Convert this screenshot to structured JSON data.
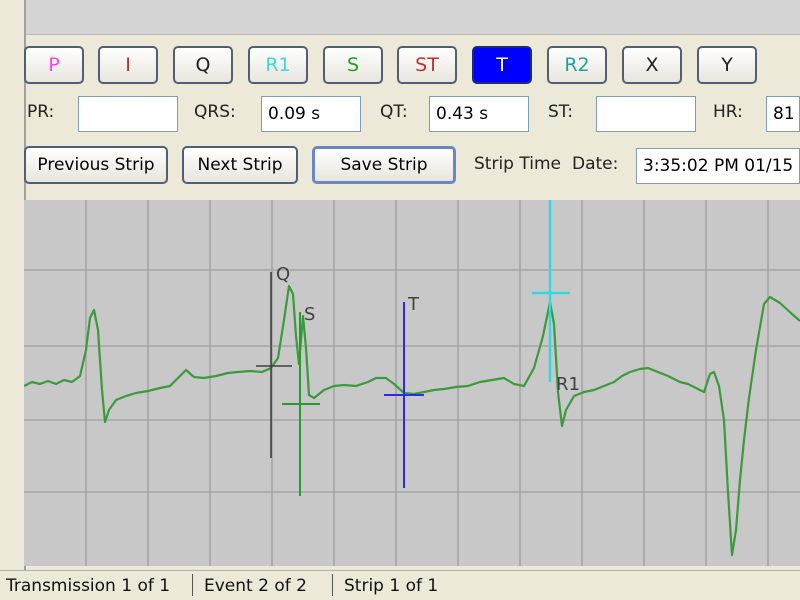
{
  "markers": [
    {
      "label": "P",
      "color": "#ff40ff",
      "bg": "",
      "selected": false
    },
    {
      "label": "I",
      "color": "#c03030",
      "bg": "",
      "selected": false
    },
    {
      "label": "Q",
      "color": "#202020",
      "bg": "",
      "selected": false
    },
    {
      "label": "R1",
      "color": "#40d8d8",
      "bg": "",
      "selected": false
    },
    {
      "label": "S",
      "color": "#20a020",
      "bg": "",
      "selected": false
    },
    {
      "label": "ST",
      "color": "#c03030",
      "bg": "",
      "selected": false
    },
    {
      "label": "T",
      "color": "#ffffff",
      "bg": "#0000ff",
      "selected": true
    },
    {
      "label": "R2",
      "color": "#20a0a0",
      "bg": "",
      "selected": false
    },
    {
      "label": "X",
      "color": "#202020",
      "bg": "",
      "selected": false
    },
    {
      "label": "Y",
      "color": "#202020",
      "bg": "",
      "selected": false
    }
  ],
  "measurements": {
    "pr": {
      "label": "PR:",
      "value": ""
    },
    "qrs": {
      "label": "QRS:",
      "value": "0.09 s"
    },
    "qt": {
      "label": "QT:",
      "value": "0.43 s"
    },
    "st": {
      "label": "ST:",
      "value": ""
    },
    "hr": {
      "label": "HR:",
      "value": "81"
    }
  },
  "actions": {
    "previous": "Previous Strip",
    "next": "Next Strip",
    "save": "Save Strip"
  },
  "strip": {
    "time_label": "Strip Time",
    "date_label": "Date:",
    "datetime_value": "3:35:02 PM 01/15"
  },
  "ecg": {
    "trace_color": "#3c9a3c",
    "grid_color": "#9e9e9e",
    "background": "#c8c8c8",
    "markers": [
      {
        "label": "Q",
        "color": "#404040"
      },
      {
        "label": "S",
        "color": "#2a9a2a"
      },
      {
        "label": "T",
        "color": "#2a2af0"
      },
      {
        "label": "R1",
        "color": "#30d8e0"
      }
    ]
  },
  "status": {
    "transmission": "Transmission 1 of 1",
    "event": "Event 2 of 2",
    "strip": "Strip 1 of 1"
  }
}
